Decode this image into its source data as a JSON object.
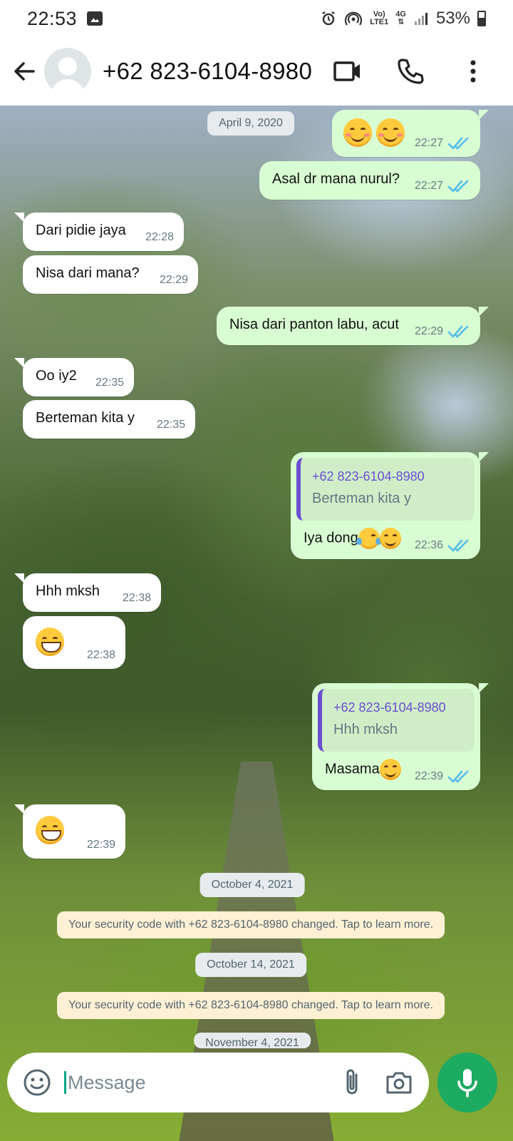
{
  "status_bar": {
    "time": "22:53",
    "lte_top": "Vo)",
    "lte_bottom": "LTE1",
    "net": "4G",
    "battery": "53%"
  },
  "header": {
    "contact_name": "+62 823-6104-8980"
  },
  "chat": {
    "date_1": "April 9, 2020",
    "m1_time": "22:27",
    "m2_text": "Asal dr mana nurul?",
    "m2_time": "22:27",
    "m3_text": "Dari pidie jaya",
    "m3_time": "22:28",
    "m4_text": "Nisa dari mana?",
    "m4_time": "22:29",
    "m5_text": "Nisa dari panton labu, acut",
    "m5_time": "22:29",
    "m6_text": "Oo iy2",
    "m6_time": "22:35",
    "m7_text": "Berteman kita y",
    "m7_time": "22:35",
    "m8_quote_name": "+62 823-6104-8980",
    "m8_quote_text": "Berteman kita y",
    "m8_text": "Iya dong",
    "m8_time": "22:36",
    "m9_text": "Hhh mksh",
    "m9_time": "22:38",
    "m10_time": "22:38",
    "m11_quote_name": "+62 823-6104-8980",
    "m11_quote_text": "Hhh mksh",
    "m11_text": "Masama",
    "m11_time": "22:39",
    "m12_time": "22:39",
    "date_2": "October 4, 2021",
    "sys_1": "Your security code with +62 823-6104-8980 changed. Tap to learn more.",
    "date_3": "October 14, 2021",
    "sys_2": "Your security code with +62 823-6104-8980 changed. Tap to learn more.",
    "date_4": "November 4, 2021"
  },
  "input": {
    "placeholder": "Message"
  },
  "colors": {
    "accent": "#1daa61",
    "outgoing_bubble": "#d9fdd3",
    "read_ticks": "#53bdeb",
    "quote_bar": "#6b4fd0"
  }
}
